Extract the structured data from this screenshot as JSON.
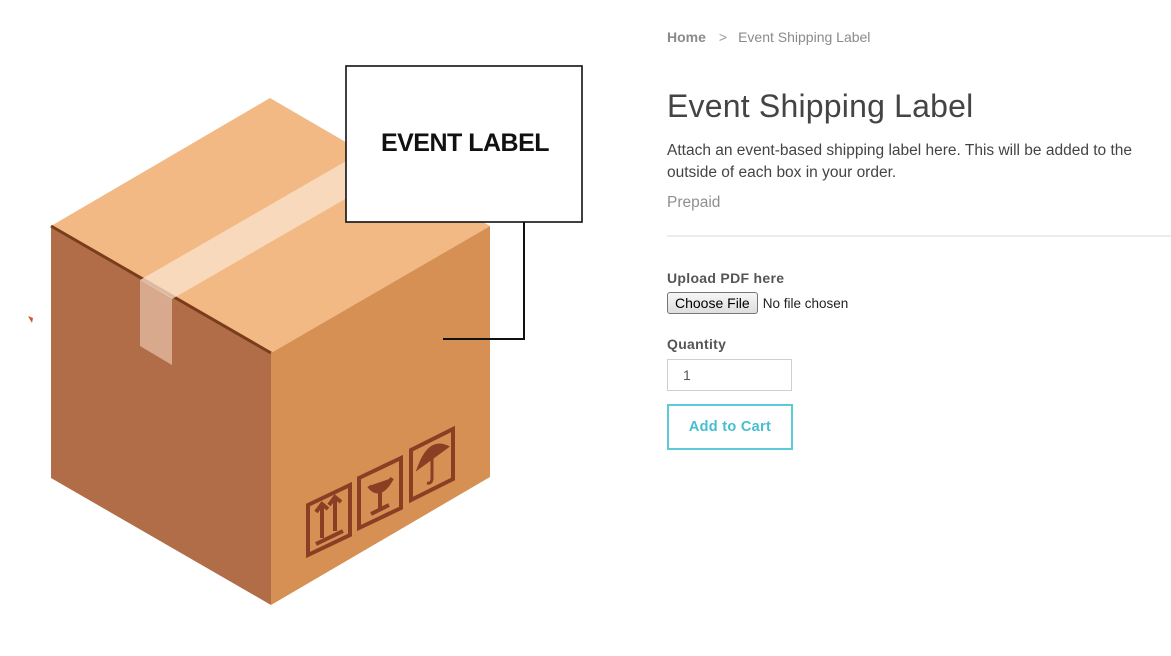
{
  "product_image": {
    "label_text": "EVENT LABEL",
    "colors": {
      "box_top": "#f2b985",
      "box_left": "#b06d48",
      "box_right": "#d69053",
      "tape": "#fbe4cf",
      "symbols": "#8a3e24"
    }
  },
  "breadcrumb": {
    "home": "Home",
    "separator": ">",
    "current": "Event Shipping Label"
  },
  "product": {
    "title": "Event Shipping Label",
    "description": "Attach an event-based shipping label here. This will be added to the outside of each box in your order.",
    "price": "Prepaid"
  },
  "upload": {
    "label": "Upload PDF here",
    "button": "Choose File",
    "status": "No file chosen"
  },
  "quantity": {
    "label": "Quantity",
    "value": "1"
  },
  "cart": {
    "button": "Add to Cart",
    "accent_color": "#5bcad9"
  }
}
